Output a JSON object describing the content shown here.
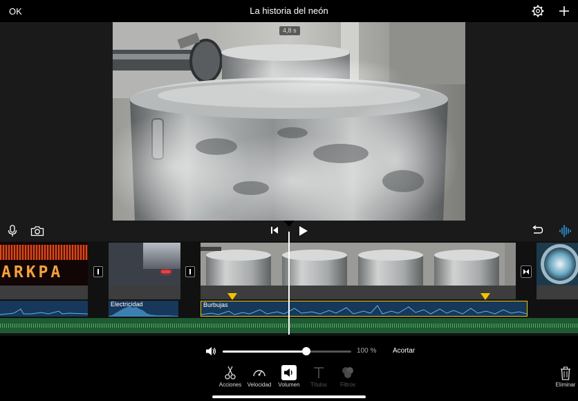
{
  "header": {
    "ok_label": "OK",
    "title": "La historia del neón"
  },
  "viewer": {
    "duration_badge": "4,8 s"
  },
  "timeline": {
    "clip_sign_text": "ARKPA",
    "audio_tracks": [
      {
        "label": "Electricidad"
      },
      {
        "label": "Burbujas"
      }
    ]
  },
  "volume": {
    "percent_label": "100 %",
    "level": 0.65,
    "trim_label": "Acortar"
  },
  "actions": [
    {
      "label": "Acciones",
      "icon": "scissors-icon",
      "enabled": true
    },
    {
      "label": "Velocidad",
      "icon": "speedometer-icon",
      "enabled": true
    },
    {
      "label": "Volumen",
      "icon": "volume-icon",
      "enabled": true,
      "selected": true
    },
    {
      "label": "Títulos",
      "icon": "title-t-icon",
      "enabled": false
    },
    {
      "label": "Filtros",
      "icon": "filters-icon",
      "enabled": false
    }
  ],
  "delete_label": "Eliminar",
  "colors": {
    "accent_blue": "#2f9be0",
    "selection_yellow": "#f2c400",
    "audio_track": "#17385a",
    "music_track": "#1f5a32"
  }
}
